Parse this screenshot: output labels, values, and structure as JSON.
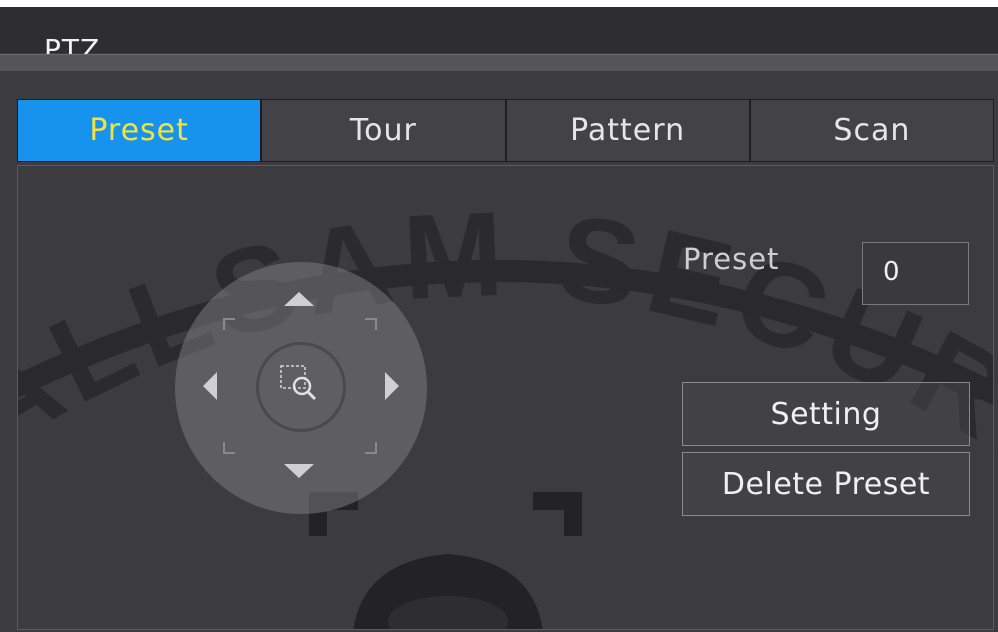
{
  "window": {
    "title": "PTZ"
  },
  "tabs": [
    {
      "label": "Preset",
      "active": true
    },
    {
      "label": "Tour",
      "active": false
    },
    {
      "label": "Pattern",
      "active": false
    },
    {
      "label": "Scan",
      "active": false
    }
  ],
  "preset": {
    "label": "Preset",
    "value": "0"
  },
  "buttons": {
    "setting": "Setting",
    "delete_preset": "Delete Preset"
  },
  "watermark": {
    "text": "ALLSAM SECURITY"
  },
  "icons": {
    "up": "arrow-up-icon",
    "down": "arrow-down-icon",
    "left": "arrow-left-icon",
    "right": "arrow-right-icon",
    "zoom": "zoom-icon"
  },
  "colors": {
    "active_tab": "#1793ee",
    "active_tab_text": "#f3e33a",
    "background": "#3c3c40"
  }
}
